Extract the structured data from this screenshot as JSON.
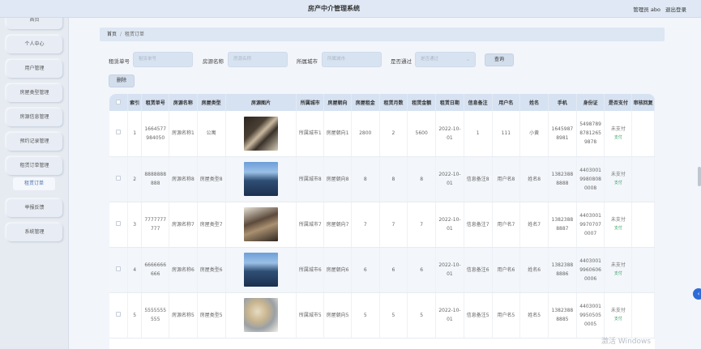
{
  "app": {
    "title": "房产中介管理系统",
    "role": "管理员 abo",
    "logout": "退出登录"
  },
  "sidebar": {
    "items": [
      "首页",
      "个人中心",
      "用户管理",
      "房屋类型管理",
      "房源信息管理",
      "预约记录管理",
      "租赁订单管理",
      "举报反馈",
      "系统管理"
    ],
    "sub_item": "租赁订单"
  },
  "breadcrumb": {
    "home": "首页",
    "current": "租赁订单"
  },
  "search": {
    "order_no_label": "租赁单号",
    "order_no_placeholder": "租赁单号",
    "house_name_label": "房源名称",
    "house_name_placeholder": "房源名称",
    "city_label": "所属城市",
    "city_placeholder": "所属城市",
    "passed_label": "是否通过",
    "passed_placeholder": "是否通过",
    "query_button": "查询",
    "delete_button": "删除"
  },
  "table": {
    "columns": [
      "索引",
      "租赁单号",
      "房源名称",
      "房屋类型",
      "房源图片",
      "所属城市",
      "房屋朝向",
      "房屋租金",
      "租赁月数",
      "租赁金额",
      "租赁日期",
      "信息备注",
      "用户名",
      "姓名",
      "手机",
      "身份证",
      "是否支付",
      "审核回复"
    ],
    "rows": [
      {
        "index": "1",
        "order_no": "1664577984050",
        "house_name": "房源名称1",
        "house_type": "公寓",
        "image": "living-room-photo",
        "city": "所属城市1",
        "orientation": "房屋朝向1",
        "rent": "2800",
        "months": "2",
        "amount": "5600",
        "date": "2022-10-01",
        "note": "1",
        "username": "111",
        "name": "小黄",
        "phone": "16459878981",
        "id_card": "549878987812659878",
        "pay_status": "未支付",
        "pay_action": "支付",
        "reply": ""
      },
      {
        "index": "2",
        "order_no": "8888888888",
        "house_name": "房源名称8",
        "house_type": "房屋类型8",
        "image": "tower-photo",
        "city": "所属城市8",
        "orientation": "房屋朝向8",
        "rent": "8",
        "months": "8",
        "amount": "8",
        "date": "2022-10-01",
        "note": "信息备注8",
        "username": "用户名8",
        "name": "姓名8",
        "phone": "13823888888",
        "id_card": "440300199808080008",
        "pay_status": "未支付",
        "pay_action": "支付",
        "reply": ""
      },
      {
        "index": "3",
        "order_no": "7777777777",
        "house_name": "房源名称7",
        "house_type": "房屋类型7",
        "image": "bedroom-photo",
        "city": "所属城市7",
        "orientation": "房屋朝向7",
        "rent": "7",
        "months": "7",
        "amount": "7",
        "date": "2022-10-01",
        "note": "信息备注7",
        "username": "用户名7",
        "name": "姓名7",
        "phone": "13823888887",
        "id_card": "440300199707070007",
        "pay_status": "未支付",
        "pay_action": "支付",
        "reply": ""
      },
      {
        "index": "4",
        "order_no": "6666666666",
        "house_name": "房源名称6",
        "house_type": "房屋类型6",
        "image": "tower-photo",
        "city": "所属城市6",
        "orientation": "房屋朝向6",
        "rent": "6",
        "months": "6",
        "amount": "6",
        "date": "2022-10-01",
        "note": "信息备注6",
        "username": "用户名6",
        "name": "姓名6",
        "phone": "13823888886",
        "id_card": "440300199606060006",
        "pay_status": "未支付",
        "pay_action": "支付",
        "reply": ""
      },
      {
        "index": "5",
        "order_no": "5555555555",
        "house_name": "房源名称5",
        "house_type": "房屋类型5",
        "image": "floorplan-photo",
        "city": "所属城市5",
        "orientation": "房屋朝向5",
        "rent": "5",
        "months": "5",
        "amount": "5",
        "date": "2022-10-01",
        "note": "信息备注5",
        "username": "用户名5",
        "name": "姓名5",
        "phone": "13823888885",
        "id_card": "440300199505050005",
        "pay_status": "未支付",
        "pay_action": "支付",
        "reply": ""
      }
    ]
  },
  "watermark": "激活 Windows"
}
